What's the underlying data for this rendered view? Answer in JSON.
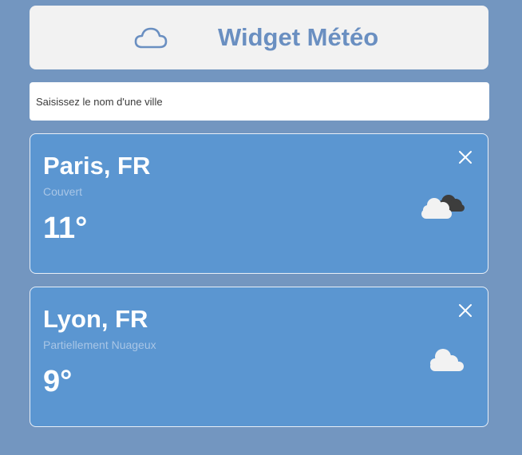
{
  "header": {
    "title": "Widget Météo",
    "logo_icon": "cloud-outline-icon",
    "accent_color": "#6a8fc1"
  },
  "search": {
    "placeholder": "Saisissez le nom d'une ville",
    "value": ""
  },
  "cards": [
    {
      "city": "Paris, FR",
      "description": "Couvert",
      "temperature": "11°",
      "icon": "overcast-clouds-icon",
      "close_icon": "close-icon"
    },
    {
      "city": "Lyon, FR",
      "description": "Partiellement Nuageux",
      "temperature": "9°",
      "icon": "partly-cloudy-icon",
      "close_icon": "close-icon"
    }
  ],
  "colors": {
    "background": "#7396c0",
    "card": "#5b96d1",
    "header": "#f2f2f2"
  }
}
